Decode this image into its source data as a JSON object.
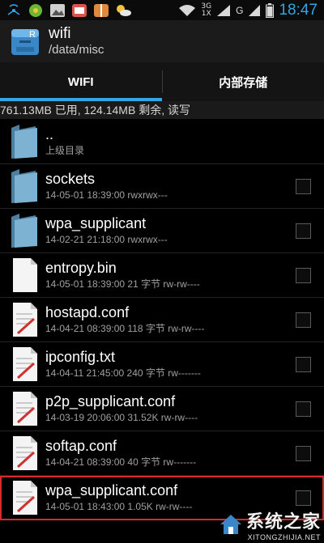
{
  "status_bar": {
    "network_type_top": "3G",
    "network_type_bottom": "1X",
    "signal_label": "G",
    "time": "18:47",
    "icons": [
      "wifi-signal-icon",
      "app-green-icon",
      "gallery-icon",
      "app-mail-icon",
      "app-gift-icon",
      "weather-icon"
    ]
  },
  "action_bar": {
    "title": "wifi",
    "path": "/data/misc"
  },
  "tabs": [
    {
      "label": "WIFI",
      "active": true
    },
    {
      "label": "内部存储",
      "active": false
    }
  ],
  "storage_info": "761.13MB 已用, 124.14MB 剩余, 读写",
  "files": [
    {
      "name": "..",
      "meta": "上级目录",
      "type": "folder",
      "checkbox": false
    },
    {
      "name": "sockets",
      "meta": "14-05-01 18:39:00   rwxrwx---",
      "type": "folder",
      "checkbox": true
    },
    {
      "name": "wpa_supplicant",
      "meta": "14-02-21 21:18:00   rwxrwx---",
      "type": "folder",
      "checkbox": true
    },
    {
      "name": "entropy.bin",
      "meta": "14-05-01 18:39:00  21 字节  rw-rw----",
      "type": "file",
      "checkbox": true
    },
    {
      "name": "hostapd.conf",
      "meta": "14-04-21 08:39:00  118 字节  rw-rw----",
      "type": "text",
      "checkbox": true
    },
    {
      "name": "ipconfig.txt",
      "meta": "14-04-11 21:45:00  240 字节  rw-------",
      "type": "text",
      "checkbox": true
    },
    {
      "name": "p2p_supplicant.conf",
      "meta": "14-03-19 20:06:00  31.52K  rw-rw----",
      "type": "text",
      "checkbox": true
    },
    {
      "name": "softap.conf",
      "meta": "14-04-21 08:39:00  40 字节  rw-------",
      "type": "text",
      "checkbox": true
    },
    {
      "name": "wpa_supplicant.conf",
      "meta": "14-05-01 18:43:00  1.05K  rw-rw----",
      "type": "text",
      "checkbox": true,
      "highlighted": true
    }
  ],
  "watermark": {
    "cn": "系统之家",
    "en": "XITONGZHIJIA.NET"
  },
  "colors": {
    "accent": "#33a8e0",
    "highlight_border": "#d42a2a",
    "folder": "#5b8fb0"
  }
}
